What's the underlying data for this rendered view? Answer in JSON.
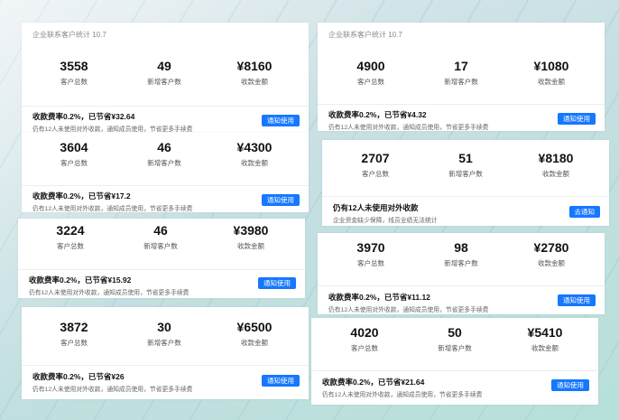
{
  "caption": "企业联系客户统计 10.7",
  "labels": {
    "total": "客户总数",
    "new": "新增客户数",
    "amount": "收款金额"
  },
  "notify_button": "通知使用",
  "cards": [
    {
      "total": "3558",
      "new": "49",
      "amount": "¥8160",
      "line1": "收款费率0.2%，已节省¥32.64",
      "line2": "仍有12人未使用对外收款，通知成员使用，节省更多手续费"
    },
    {
      "total": "3604",
      "new": "46",
      "amount": "¥4300",
      "line1": "收款费率0.2%，已节省¥17.2",
      "line2": "仍有12人未使用对外收款，通知成员使用，节省更多手续费"
    },
    {
      "total": "3224",
      "new": "46",
      "amount": "¥3980",
      "line1": "收款费率0.2%，已节省¥15.92",
      "line2": "仍有12人未使用对外收款，通知成员使用，节省更多手续费"
    },
    {
      "total": "3872",
      "new": "30",
      "amount": "¥6500",
      "line1": "收款费率0.2%，已节省¥26",
      "line2": "仍有12人未使用对外收款，通知成员使用，节省更多手续费"
    },
    {
      "total": "4900",
      "new": "17",
      "amount": "¥1080",
      "line1": "收款费率0.2%，已节省¥4.32",
      "line2": "仍有12人未使用对外收款，通知成员使用，节省更多手续费"
    },
    {
      "total": "2707",
      "new": "51",
      "amount": "¥8180",
      "line1": "仍有12人未使用对外收款",
      "line2": "企业资金缺少保障，线员业绩无法统计",
      "button": "去通知"
    },
    {
      "total": "3970",
      "new": "98",
      "amount": "¥2780",
      "line1": "收款费率0.2%，已节省¥11.12",
      "line2": "仍有12人未使用对外收款，通知成员使用，节省更多手续费"
    },
    {
      "total": "4020",
      "new": "50",
      "amount": "¥5410",
      "line1": "收款费率0.2%，已节省¥21.64",
      "line2": "仍有12人未使用对外收款，通知成员使用，节省更多手续费"
    }
  ]
}
